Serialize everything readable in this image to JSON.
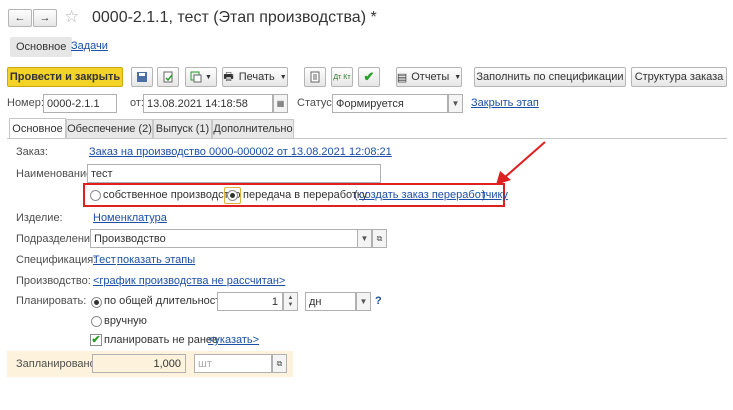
{
  "window": {
    "title": "0000-2.1.1, тест (Этап производства) *"
  },
  "nav": {
    "main": "Основное",
    "tasks": "Задачи"
  },
  "toolbar": {
    "post_close": "Провести и закрыть",
    "print": "Печать",
    "reports": "Отчеты",
    "fill_by_spec": "Заполнить по спецификации",
    "order_structure": "Структура заказа",
    "dtkt": "Дт Кт"
  },
  "header": {
    "number_label": "Номер:",
    "number_value": "0000-2.1.1",
    "from_label": "от:",
    "date_value": "13.08.2021 14:18:58",
    "status_label": "Статус:",
    "status_value": "Формируется",
    "close_stage": "Закрыть этап"
  },
  "tabs": [
    "Основное",
    "Обеспечение (2)",
    "Выпуск (1)",
    "Дополнительно"
  ],
  "form": {
    "order_label": "Заказ:",
    "order_link": "Заказ на производство 0000-000002 от 13.08.2021 12:08:21",
    "name_label": "Наименование:",
    "name_value": "тест",
    "radio_own": "собственное производство",
    "radio_transfer": "передача в переработку",
    "create_order_link": "создать заказ переработчику",
    "item_label": "Изделие:",
    "item_link": "Номенклатура",
    "dept_label": "Подразделение:",
    "dept_value": "Производство",
    "spec_label": "Спецификация:",
    "spec_link": "Тест",
    "show_stages_link": "показать этапы",
    "production_label": "Производство:",
    "schedule_link": "<график производства не рассчитан>",
    "plan_label": "Планировать:",
    "plan_total": "по общей длительности",
    "duration_value": "1",
    "unit_value": "дн",
    "help": "?",
    "plan_manual": "вручную",
    "plan_not_earlier": "планировать не ранее",
    "specify_link": "<указать>",
    "planned_label": "Запланировано:",
    "planned_value": "1,000",
    "planned_unit": "шт"
  }
}
